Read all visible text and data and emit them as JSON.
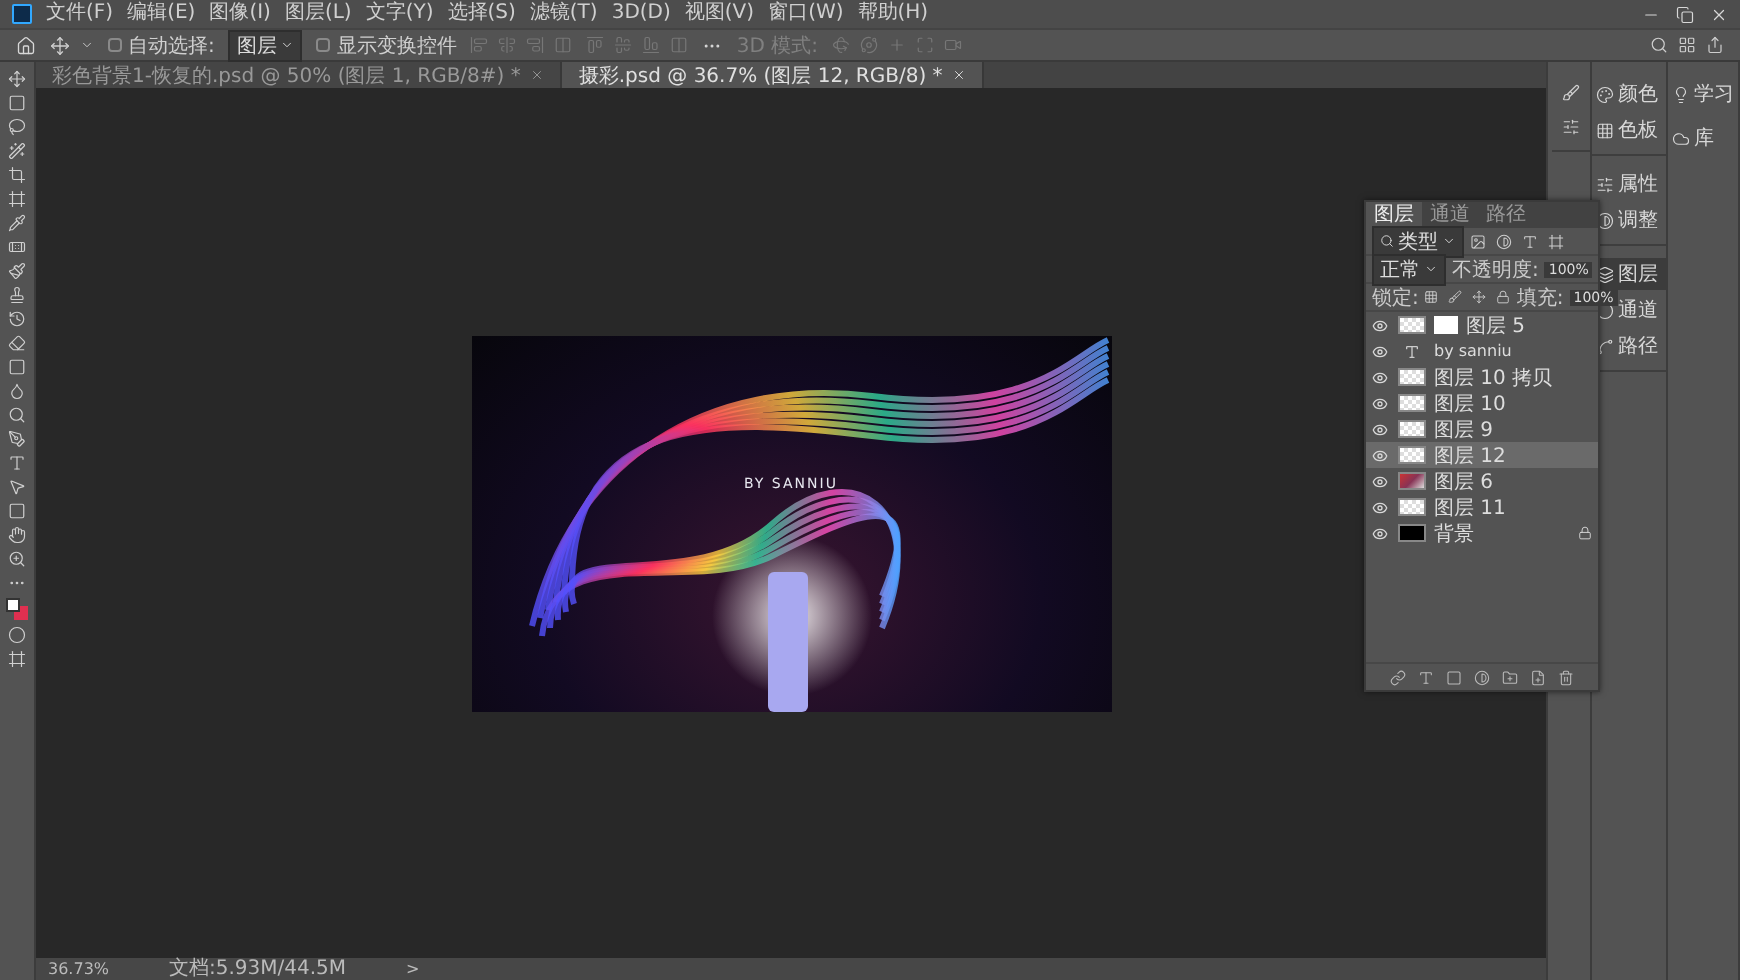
{
  "menu": [
    "文件(F)",
    "编辑(E)",
    "图像(I)",
    "图层(L)",
    "文字(Y)",
    "选择(S)",
    "滤镜(T)",
    "3D(D)",
    "视图(V)",
    "窗口(W)",
    "帮助(H)"
  ],
  "options": {
    "auto_select": {
      "label": "自动选择:",
      "checked": false
    },
    "target": "图层",
    "transform": {
      "label": "显示变换控件",
      "checked": false
    },
    "mode_3d": "3D 模式:"
  },
  "documents": [
    {
      "title": "彩色背景1-恢复的.psd @ 50% (图层 1, RGB/8#) *",
      "selected": false
    },
    {
      "title": "摄彩.psd @ 36.7% (图层 12, RGB/8) *",
      "selected": true
    }
  ],
  "canvas": {
    "caption": "BY SANNIU"
  },
  "status_bar": {
    "zoom": "36.73%",
    "doc": "文档:5.93M/44.5M",
    "arrow": ">"
  },
  "dock": {
    "groups": [
      [
        {
          "label": "颜色",
          "selected": false
        },
        {
          "label": "色板",
          "selected": false
        }
      ],
      [
        {
          "label": "属性",
          "selected": false
        },
        {
          "label": "调整",
          "selected": false
        }
      ],
      [
        {
          "label": "图层",
          "selected": true
        },
        {
          "label": "通道",
          "selected": false
        },
        {
          "label": "路径",
          "selected": false
        }
      ]
    ],
    "extra": [
      "学习",
      "库"
    ]
  },
  "layers_panel": {
    "tabs": [
      {
        "label": "图层",
        "selected": true
      },
      {
        "label": "通道",
        "selected": false
      },
      {
        "label": "路径",
        "selected": false
      }
    ],
    "filter": "类型",
    "blend": "正常",
    "opacity_label": "不透明度:",
    "opacity": "100%",
    "lock_label": "锁定:",
    "fill_label": "填充:",
    "fill": "100%",
    "layers": [
      {
        "name": "图层 5",
        "kind": "masked",
        "visible": true,
        "selected": false
      },
      {
        "name": "by sanniu",
        "kind": "text",
        "visible": true,
        "selected": false
      },
      {
        "name": "图层 10 拷贝",
        "kind": "pixel",
        "visible": true,
        "selected": false
      },
      {
        "name": "图层 10",
        "kind": "pixel",
        "visible": true,
        "selected": false
      },
      {
        "name": "图层 9",
        "kind": "pixel",
        "visible": true,
        "selected": false
      },
      {
        "name": "图层 12",
        "kind": "pixel",
        "visible": true,
        "selected": true
      },
      {
        "name": "图层 6",
        "kind": "image",
        "visible": true,
        "selected": false
      },
      {
        "name": "图层 11",
        "kind": "pixel",
        "visible": true,
        "selected": false
      },
      {
        "name": "背景",
        "kind": "background",
        "visible": true,
        "selected": false
      }
    ]
  }
}
